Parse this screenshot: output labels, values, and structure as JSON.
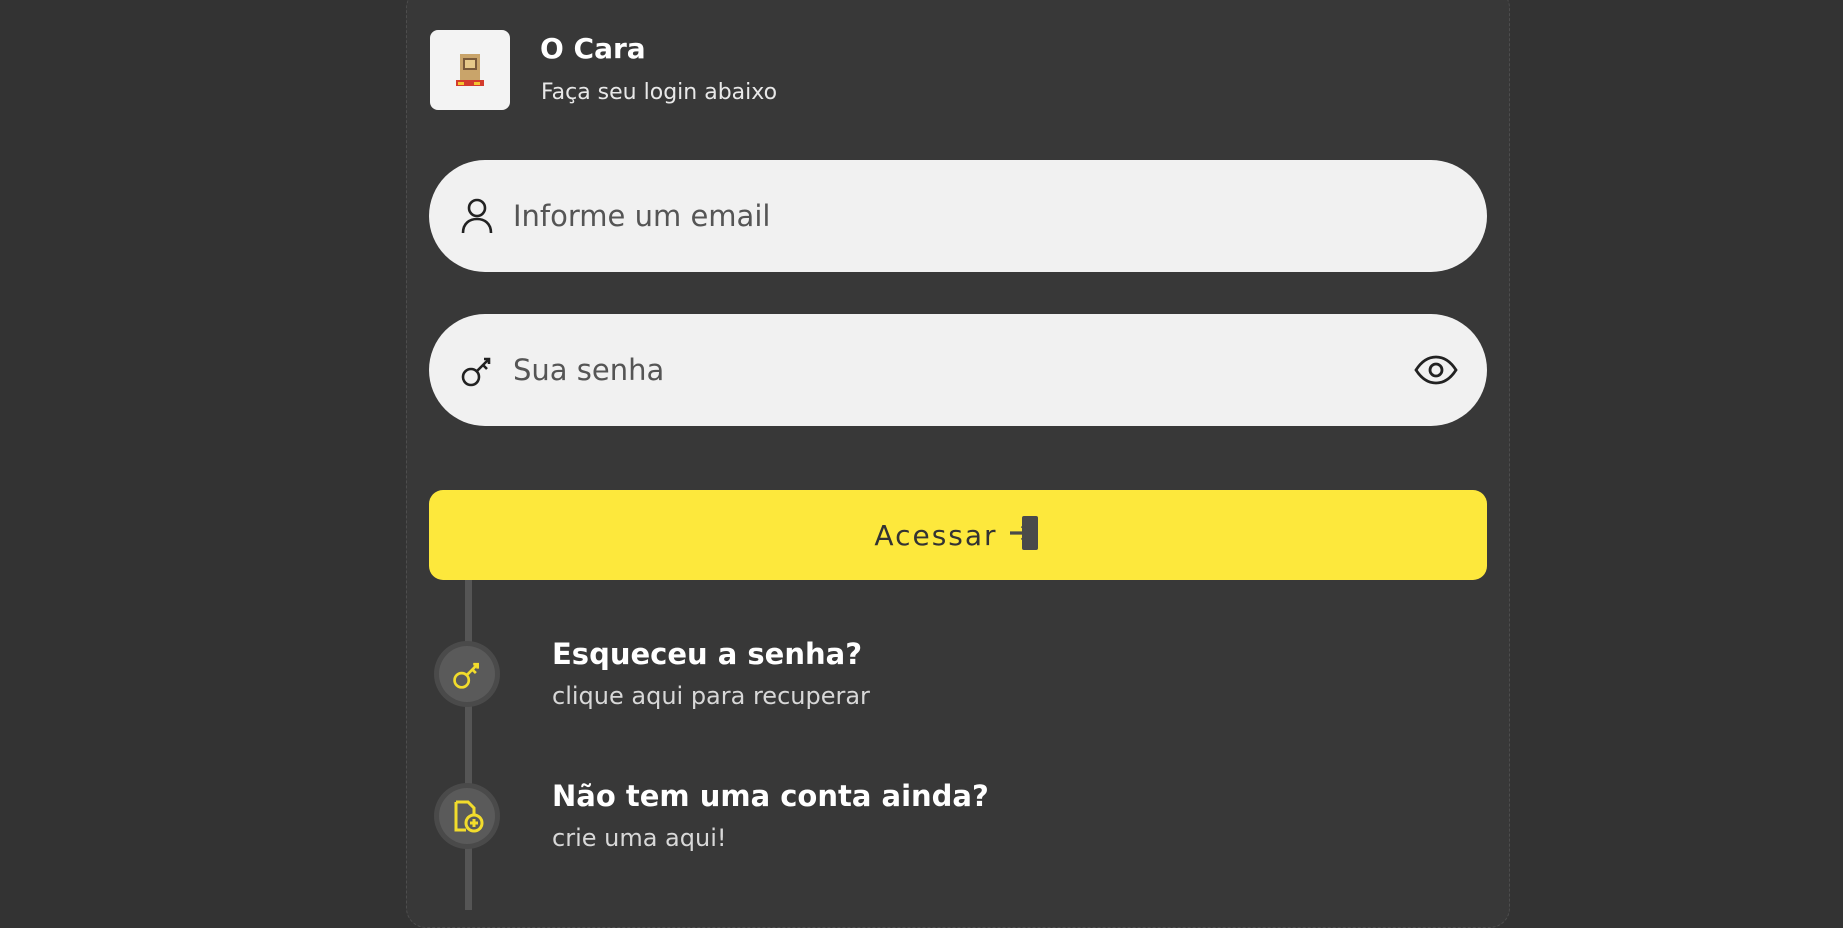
{
  "brand": {
    "title": "O Cara",
    "subtitle": "Faça seu login abaixo"
  },
  "form": {
    "email_placeholder": "Informe um email",
    "password_placeholder": "Sua senha",
    "submit_label": "Acessar"
  },
  "links": [
    {
      "title": "Esqueceu a senha?",
      "subtitle": "clique aqui para recuperar",
      "icon": "key-icon"
    },
    {
      "title": "Não tem uma conta ainda?",
      "subtitle": "crie uma aqui!",
      "icon": "new-document-icon"
    }
  ],
  "colors": {
    "background": "#333333",
    "card": "#383838",
    "input": "#f1f1f1",
    "accent": "#fde83c",
    "icon_accent": "#f2dc2c"
  }
}
